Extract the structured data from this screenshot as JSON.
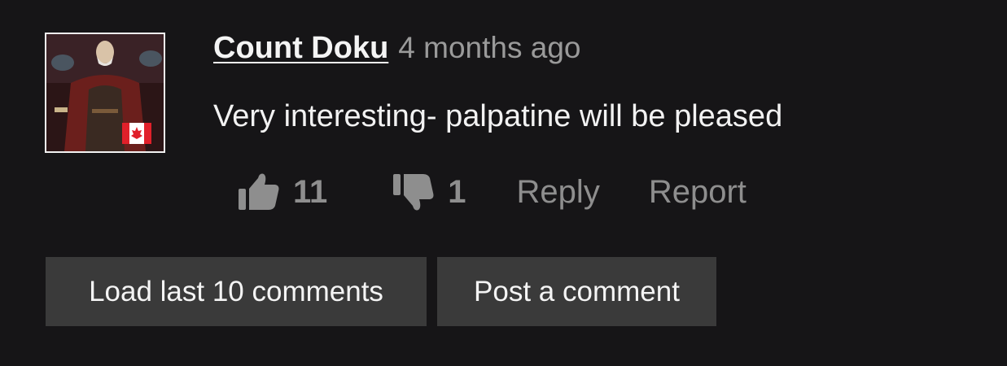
{
  "comment": {
    "author": "Count Doku",
    "timestamp": "4 months ago",
    "text": "Very interesting- palpatine will be pleased",
    "avatar_icon": "avatar-with-canada-flag",
    "likes": "11",
    "dislikes": "1",
    "reply_label": "Reply",
    "report_label": "Report"
  },
  "buttons": {
    "load_comments": "Load last 10 comments",
    "post_comment": "Post a comment"
  },
  "colors": {
    "background": "#161517",
    "text": "#f4f4f4",
    "muted": "#8e8e8e",
    "button_bg": "#3a3a3a",
    "flag_red": "#e0202a"
  }
}
